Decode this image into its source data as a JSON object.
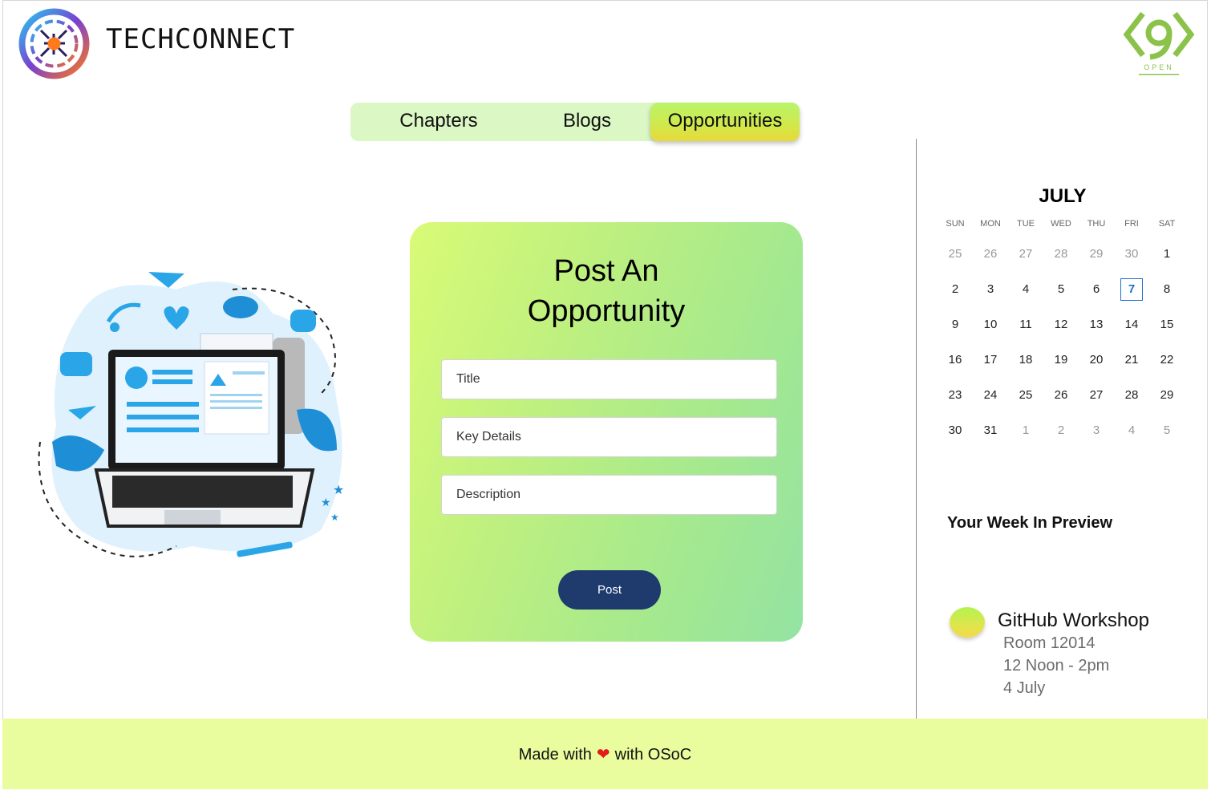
{
  "header": {
    "brand": "TECHCONNECT"
  },
  "nav": {
    "tabs": [
      {
        "label": "Chapters"
      },
      {
        "label": "Blogs"
      },
      {
        "label": "Opportunities",
        "active": true
      }
    ]
  },
  "form": {
    "title_line1": "Post An",
    "title_line2": "Opportunity",
    "title_placeholder": "Title",
    "key_details_placeholder": "Key Details",
    "description_placeholder": "Description",
    "post_label": "Post"
  },
  "calendar": {
    "month": "JULY",
    "weekdays": [
      "SUN",
      "MON",
      "TUE",
      "WED",
      "THU",
      "FRI",
      "SAT"
    ],
    "weeks": [
      [
        "25",
        "26",
        "27",
        "28",
        "29",
        "30",
        "1"
      ],
      [
        "2",
        "3",
        "4",
        "5",
        "6",
        "7",
        "8"
      ],
      [
        "9",
        "10",
        "11",
        "12",
        "13",
        "14",
        "15"
      ],
      [
        "16",
        "17",
        "18",
        "19",
        "20",
        "21",
        "22"
      ],
      [
        "23",
        "24",
        "25",
        "26",
        "27",
        "28",
        "29"
      ],
      [
        "30",
        "31",
        "1",
        "2",
        "3",
        "4",
        "5"
      ]
    ],
    "today": "7"
  },
  "preview": {
    "title": "Your Week In Preview",
    "event": {
      "name": "GitHub Workshop",
      "room": "Room 12014",
      "time": "12 Noon - 2pm",
      "date": "4 July"
    }
  },
  "footer": {
    "made_with": "Made with",
    "with_osoc": "with OSoC",
    "heart": "❤"
  },
  "colors": {
    "nav_bg": "#dbf7c4",
    "accent": "#1f3b6e",
    "footer_bg": "#e9fc9e",
    "today": "#1e6fd0"
  }
}
